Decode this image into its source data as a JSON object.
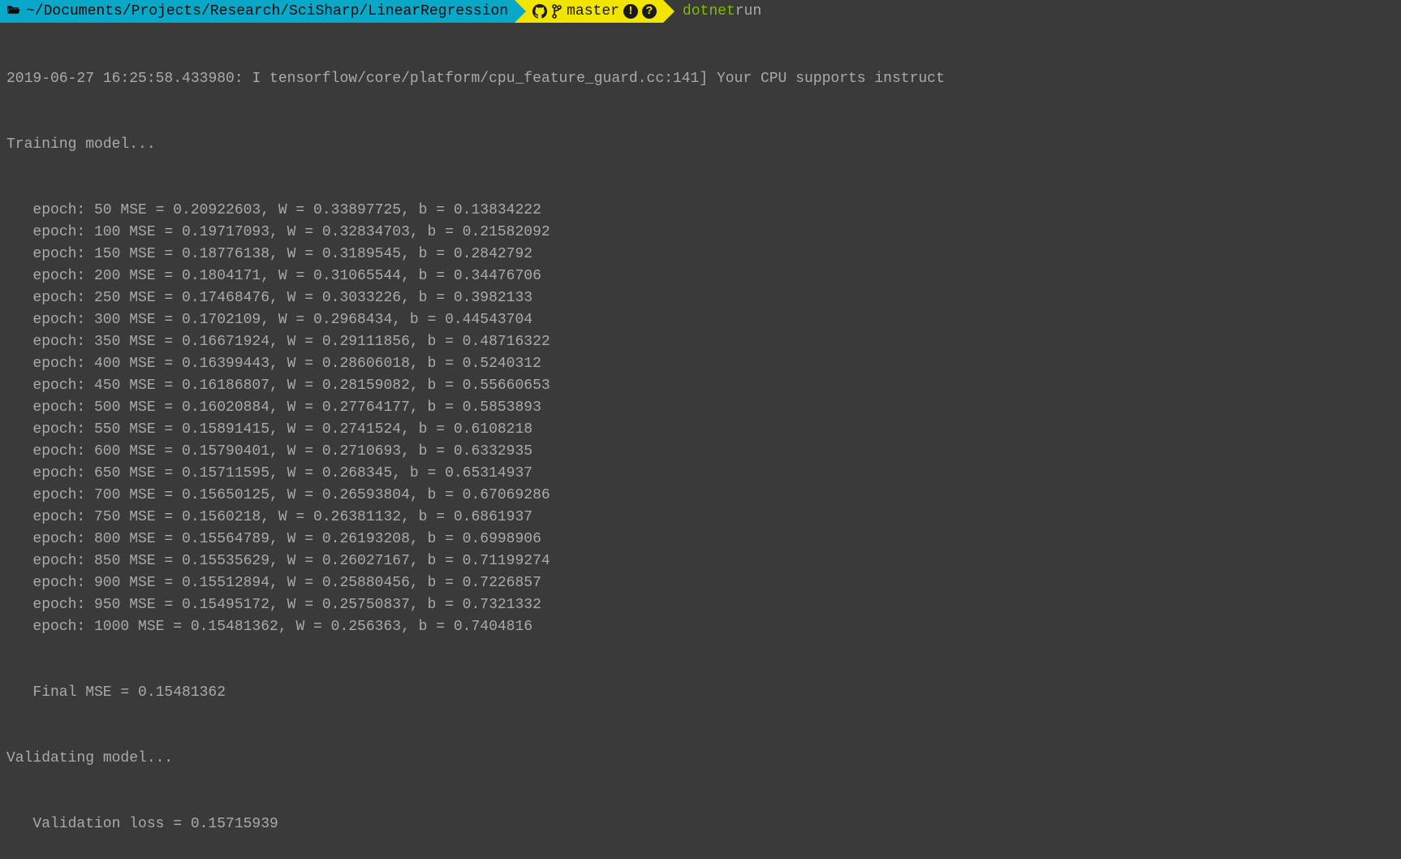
{
  "prompt": {
    "path": "~/Documents/Projects/Research/SciSharp/LinearRegression",
    "branch": "master",
    "cmd_part1": "dotnet",
    "cmd_part2": " run"
  },
  "output": {
    "tf_line": "2019-06-27 16:25:58.433980: I tensorflow/core/platform/cpu_feature_guard.cc:141] Your CPU supports instruct",
    "training_header": "Training model...",
    "epochs": [
      "epoch: 50 MSE = 0.20922603, W = 0.33897725, b = 0.13834222",
      "epoch: 100 MSE = 0.19717093, W = 0.32834703, b = 0.21582092",
      "epoch: 150 MSE = 0.18776138, W = 0.3189545, b = 0.2842792",
      "epoch: 200 MSE = 0.1804171, W = 0.31065544, b = 0.34476706",
      "epoch: 250 MSE = 0.17468476, W = 0.3033226, b = 0.3982133",
      "epoch: 300 MSE = 0.1702109, W = 0.2968434, b = 0.44543704",
      "epoch: 350 MSE = 0.16671924, W = 0.29111856, b = 0.48716322",
      "epoch: 400 MSE = 0.16399443, W = 0.28606018, b = 0.5240312",
      "epoch: 450 MSE = 0.16186807, W = 0.28159082, b = 0.55660653",
      "epoch: 500 MSE = 0.16020884, W = 0.27764177, b = 0.5853893",
      "epoch: 550 MSE = 0.15891415, W = 0.2741524, b = 0.6108218",
      "epoch: 600 MSE = 0.15790401, W = 0.2710693, b = 0.6332935",
      "epoch: 650 MSE = 0.15711595, W = 0.268345, b = 0.65314937",
      "epoch: 700 MSE = 0.15650125, W = 0.26593804, b = 0.67069286",
      "epoch: 750 MSE = 0.1560218, W = 0.26381132, b = 0.6861937",
      "epoch: 800 MSE = 0.15564789, W = 0.26193208, b = 0.6998906",
      "epoch: 850 MSE = 0.15535629, W = 0.26027167, b = 0.71199274",
      "epoch: 900 MSE = 0.15512894, W = 0.25880456, b = 0.7226857",
      "epoch: 950 MSE = 0.15495172, W = 0.25750837, b = 0.7321332",
      "epoch: 1000 MSE = 0.15481362, W = 0.256363, b = 0.7404816"
    ],
    "final_mse": "Final MSE = 0.15481362",
    "validating_header": "Validating model...",
    "validation_loss": "Validation loss = 0.15715939"
  }
}
